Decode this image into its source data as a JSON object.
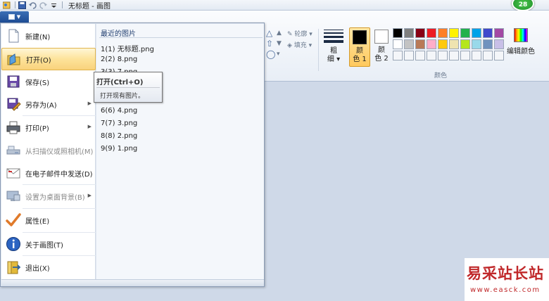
{
  "window": {
    "title": "无标题 - 画图",
    "notification_count": "28"
  },
  "ribbon": {
    "outline_label": "轮廓",
    "fill_label": "填充",
    "thickness_label_line1": "粗",
    "thickness_label_line2": "细",
    "color1_label_line1": "颜",
    "color1_label_line2": "色 1",
    "color2_label_line1": "颜",
    "color2_label_line2": "色 2",
    "edit_colors_label": "编辑颜色",
    "colors_group_label": "颜色",
    "color1_value": "#000000",
    "color2_value": "#ffffff",
    "palette_row1": [
      "#000000",
      "#7f7f7f",
      "#880015",
      "#ed1c24",
      "#ff7f27",
      "#fff200",
      "#22b14c",
      "#00a2e8",
      "#3f48cc",
      "#a349a4"
    ],
    "palette_row2": [
      "#ffffff",
      "#c3c3c3",
      "#b97a57",
      "#ffaec9",
      "#ffc90e",
      "#efe4b0",
      "#b5e61d",
      "#99d9ea",
      "#7092be",
      "#c8bfe7"
    ],
    "palette_row3": [
      "#f4f6f9",
      "#f4f6f9",
      "#f4f6f9",
      "#f4f6f9",
      "#f4f6f9",
      "#f4f6f9",
      "#f4f6f9",
      "#f4f6f9",
      "#f4f6f9",
      "#f4f6f9"
    ]
  },
  "menu": {
    "items": [
      {
        "label": "新建(N)",
        "icon": "new-file-icon"
      },
      {
        "label": "打开(O)",
        "icon": "open-folder-icon"
      },
      {
        "label": "保存(S)",
        "icon": "save-disk-icon"
      },
      {
        "label": "另存为(A)",
        "icon": "save-as-icon"
      },
      {
        "label": "打印(P)",
        "icon": "printer-icon"
      },
      {
        "label": "从扫描仪或照相机(M)",
        "icon": "scanner-icon"
      },
      {
        "label": "在电子邮件中发送(D)",
        "icon": "email-icon"
      },
      {
        "label": "设置为桌面背景(B)",
        "icon": "desktop-background-icon"
      },
      {
        "label": "属性(E)",
        "icon": "checkmark-icon"
      },
      {
        "label": "关于画图(T)",
        "icon": "info-icon"
      },
      {
        "label": "退出(X)",
        "icon": "exit-icon"
      }
    ],
    "recent_header": "最近的图片",
    "recent": [
      "1(1)  无标题.png",
      "2(2)  8.png",
      "3(3)  7.png",
      "6(6)  4.png",
      "7(7)  3.png",
      "8(8)  2.png",
      "9(9)  1.png"
    ]
  },
  "tooltip": {
    "title": "打开(Ctrl+O)",
    "description": "打开现有图片。"
  },
  "watermark": {
    "text": "易采站长站",
    "url": "www.easck.com"
  }
}
